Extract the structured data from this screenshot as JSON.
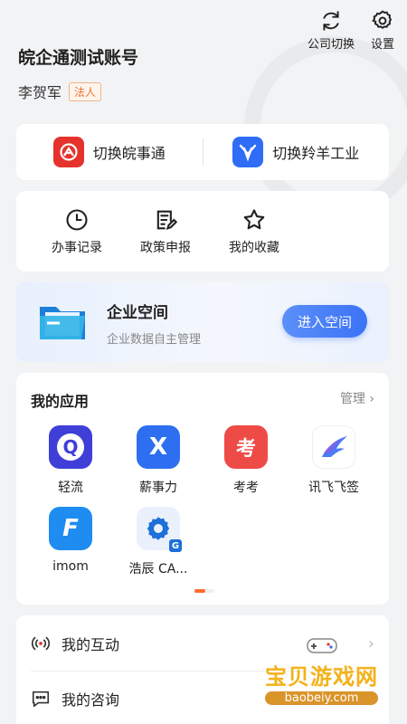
{
  "header": {
    "account_name": "皖企通测试账号",
    "person_name": "李贺军",
    "role_badge": "法人",
    "actions": [
      {
        "label": "公司切换",
        "icon": "refresh-icon"
      },
      {
        "label": "设置",
        "icon": "gear-icon"
      }
    ]
  },
  "switch": {
    "left": {
      "label": "切换皖事通",
      "icon": "wanshitong-logo",
      "color": "#e5322d"
    },
    "right": {
      "label": "切换羚羊工业",
      "icon": "lingyang-logo",
      "color": "#2f6df6"
    }
  },
  "quick": [
    {
      "label": "办事记录",
      "icon": "clock-icon"
    },
    {
      "label": "政策申报",
      "icon": "document-edit-icon"
    },
    {
      "label": "我的收藏",
      "icon": "star-icon"
    }
  ],
  "space": {
    "title": "企业空间",
    "subtitle": "企业数据自主管理",
    "button": "进入空间"
  },
  "apps": {
    "title": "我的应用",
    "manage": "管理",
    "items": [
      {
        "label": "轻流",
        "icon": "qingliu-icon",
        "glyph": "Q",
        "color": "#3f3fd8"
      },
      {
        "label": "薪事力",
        "icon": "xinshili-icon",
        "glyph": "X",
        "color": "#2e6ff2"
      },
      {
        "label": "考考",
        "icon": "kaokao-icon",
        "glyph": "考",
        "color": "#ee4b47"
      },
      {
        "label": "讯飞飞签",
        "icon": "xunfei-icon",
        "glyph": "",
        "color": "#ffffff"
      },
      {
        "label": "imom",
        "icon": "imom-icon",
        "glyph": "F",
        "color": "#1e8cf0"
      },
      {
        "label": "浩辰 CA...",
        "icon": "haochen-cad-icon",
        "glyph": "",
        "color": "#eaf1fc"
      }
    ]
  },
  "list": [
    {
      "label": "我的互动",
      "icon": "broadcast-icon"
    },
    {
      "label": "我的咨询",
      "icon": "chat-icon"
    }
  ],
  "watermark": {
    "title": "宝贝游戏网",
    "sub": "baobeiy.com"
  }
}
